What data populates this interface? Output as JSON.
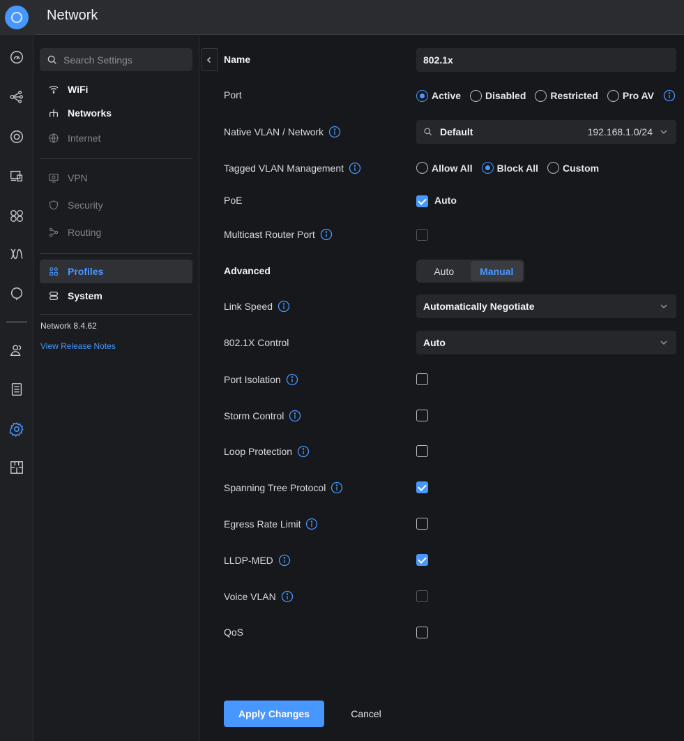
{
  "app": {
    "title": "Network"
  },
  "rail": {
    "icons": [
      "dashboard-icon",
      "topology-icon",
      "devices-icon",
      "client-devices-icon",
      "ports-icon",
      "insights-icon",
      "alerts-icon",
      "admins-icon",
      "logs-icon",
      "settings-icon",
      "floorplan-icon"
    ]
  },
  "sidebar": {
    "search_placeholder": "Search Settings",
    "items": [
      {
        "label": "WiFi"
      },
      {
        "label": "Networks"
      },
      {
        "label": "Internet"
      },
      {
        "label": "VPN"
      },
      {
        "label": "Security"
      },
      {
        "label": "Routing"
      },
      {
        "label": "Profiles"
      },
      {
        "label": "System"
      }
    ],
    "version": "Network 8.4.62",
    "release_notes": "View Release Notes"
  },
  "form": {
    "name": {
      "label": "Name",
      "value": "802.1x"
    },
    "port": {
      "label": "Port",
      "options": [
        "Active",
        "Disabled",
        "Restricted",
        "Pro AV"
      ],
      "selected": "Active"
    },
    "native_vlan": {
      "label": "Native VLAN / Network",
      "value": "Default",
      "subnet": "192.168.1.0/24"
    },
    "tagged_vlan": {
      "label": "Tagged VLAN Management",
      "options": [
        "Allow All",
        "Block All",
        "Custom"
      ],
      "selected": "Block All"
    },
    "poe": {
      "label": "PoE",
      "option": "Auto",
      "checked": true
    },
    "multicast": {
      "label": "Multicast Router Port",
      "checked": false
    },
    "advanced": {
      "label": "Advanced",
      "options": [
        "Auto",
        "Manual"
      ],
      "selected": "Manual"
    },
    "link_speed": {
      "label": "Link Speed",
      "value": "Automatically Negotiate"
    },
    "dot1x": {
      "label": "802.1X Control",
      "value": "Auto"
    },
    "port_isolation": {
      "label": "Port Isolation",
      "checked": false
    },
    "storm_control": {
      "label": "Storm Control",
      "checked": false
    },
    "loop_protection": {
      "label": "Loop Protection",
      "checked": false
    },
    "stp": {
      "label": "Spanning Tree Protocol",
      "checked": true
    },
    "egress": {
      "label": "Egress Rate Limit",
      "checked": false
    },
    "lldp": {
      "label": "LLDP-MED",
      "checked": true
    },
    "voice_vlan": {
      "label": "Voice VLAN",
      "checked": false
    },
    "qos": {
      "label": "QoS",
      "checked": false
    }
  },
  "actions": {
    "apply": "Apply Changes",
    "cancel": "Cancel"
  },
  "colors": {
    "accent": "#4797ff",
    "background": "#17181b",
    "panel": "#26272b"
  }
}
